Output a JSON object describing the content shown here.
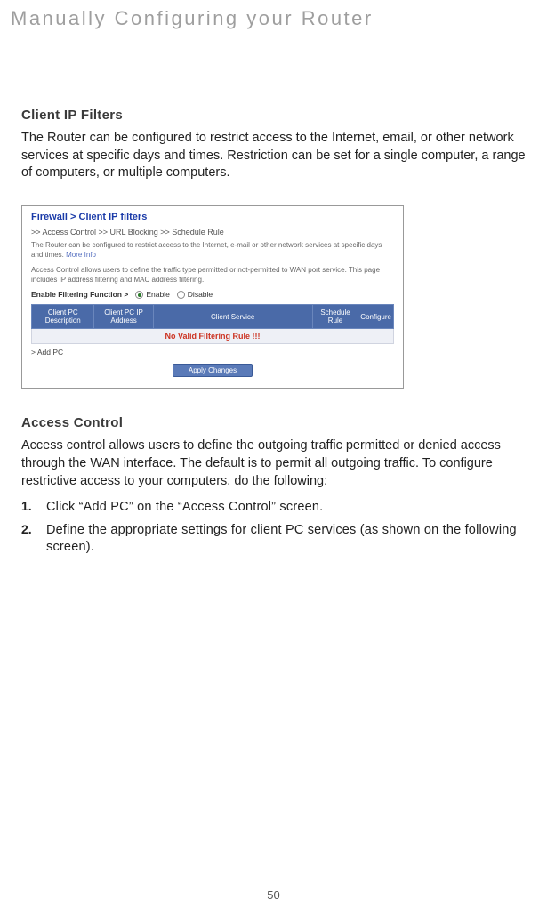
{
  "header": {
    "title": "Manually Configuring your Router"
  },
  "section1": {
    "heading": "Client IP Filters",
    "body": "The Router can be configured to restrict access to the Internet, email, or other network services at specific days and times. Restriction can be set for a single computer, a range of computers, or multiple computers."
  },
  "screenshot": {
    "title": "Firewall > Client IP filters",
    "crumbs": ">> Access Control    >> URL Blocking    >> Schedule Rule",
    "desc1": "The Router can be configured to restrict access to the Internet, e-mail or other network services at specific days and times.",
    "more_info": "More Info",
    "desc2": "Access Control allows users to define the traffic type permitted or not-permitted to WAN port service. This page includes IP address filtering and MAC address filtering.",
    "filter_label": "Enable Filtering Function >",
    "enable_label": "Enable",
    "disable_label": "Disable",
    "cols": {
      "c1": "Client PC Description",
      "c2": "Client PC IP Address",
      "c3": "Client Service",
      "c4": "Schedule Rule",
      "c5": "Configure"
    },
    "no_rule": "No Valid Filtering Rule !!!",
    "add_pc": "> Add PC",
    "apply": "Apply Changes"
  },
  "section2": {
    "heading": "Access Control",
    "body": "Access control allows users to define the outgoing traffic permitted or denied access through the WAN interface. The default is to permit all outgoing traffic. To configure restrictive access to your computers, do the following:",
    "steps": [
      {
        "num": "1.",
        "text": "Click “Add PC” on the “Access Control” screen."
      },
      {
        "num": "2.",
        "text": "Define the appropriate settings for client PC services (as shown on the following screen)."
      }
    ]
  },
  "page_number": "50"
}
